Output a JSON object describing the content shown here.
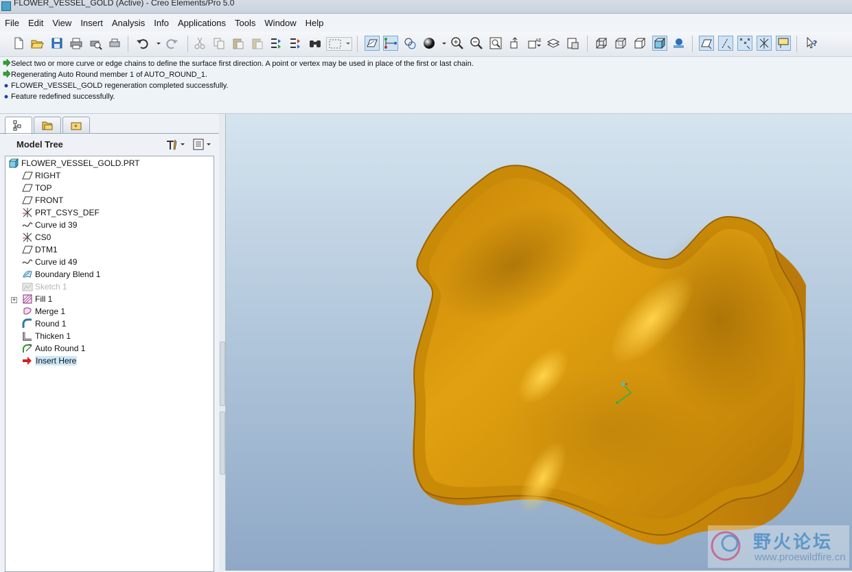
{
  "window": {
    "title": "FLOWER_VESSEL_GOLD (Active) - Creo Elements/Pro 5.0"
  },
  "menu": [
    "File",
    "Edit",
    "View",
    "Insert",
    "Analysis",
    "Info",
    "Applications",
    "Tools",
    "Window",
    "Help"
  ],
  "toolbar_icons": [
    "new-file-icon",
    "open-file-icon",
    "save-icon",
    "print-icon",
    "print-preview-icon",
    "print-setup-icon",
    "undo-icon",
    "redo-icon",
    "cut-icon",
    "copy-icon",
    "paste-icon",
    "paste-special-icon",
    "regenerate-icon",
    "regen-manager-icon",
    "find-icon",
    "selection-box-icon",
    "datum-planes-icon",
    "datum-axes-icon",
    "datum-points-icon",
    "appearance-icon",
    "zoom-in-icon",
    "zoom-out-icon",
    "refit-icon",
    "reorient-icon",
    "saved-views-icon",
    "layers-icon",
    "view-manager-icon",
    "wireframe-icon",
    "hidden-line-icon",
    "no-hidden-icon",
    "shading-icon",
    "shading-edges-icon",
    "plane-display-icon",
    "axis-display-icon",
    "point-display-icon",
    "csys-display-icon",
    "annotation-display-icon",
    "whats-this-icon"
  ],
  "messages": [
    {
      "type": "prompt",
      "text": "Select two or more curve or edge chains to define the surface first direction. A point or vertex may be used in place of the first or last chain."
    },
    {
      "type": "prompt",
      "text": "Regenerating Auto Round member 1 of AUTO_ROUND_1."
    },
    {
      "type": "info",
      "text": "FLOWER_VESSEL_GOLD regeneration completed successfully."
    },
    {
      "type": "info",
      "text": "Feature redefined successfully."
    }
  ],
  "model_tree": {
    "title": "Model Tree",
    "root": "FLOWER_VESSEL_GOLD.PRT",
    "items": [
      {
        "label": "RIGHT",
        "icon": "datum-plane-icon"
      },
      {
        "label": "TOP",
        "icon": "datum-plane-icon"
      },
      {
        "label": "FRONT",
        "icon": "datum-plane-icon"
      },
      {
        "label": "PRT_CSYS_DEF",
        "icon": "csys-icon"
      },
      {
        "label": "Curve id 39",
        "icon": "curve-icon"
      },
      {
        "label": "CS0",
        "icon": "csys-icon"
      },
      {
        "label": "DTM1",
        "icon": "datum-plane-icon"
      },
      {
        "label": "Curve id 49",
        "icon": "curve-icon"
      },
      {
        "label": "Boundary Blend 1",
        "icon": "boundary-blend-icon"
      },
      {
        "label": "Sketch 1",
        "icon": "sketch-icon",
        "suppressed": true
      },
      {
        "label": "Fill 1",
        "icon": "fill-icon",
        "expandable": true
      },
      {
        "label": "Merge 1",
        "icon": "merge-icon"
      },
      {
        "label": "Round 1",
        "icon": "round-icon"
      },
      {
        "label": "Thicken 1",
        "icon": "thicken-icon"
      },
      {
        "label": "Auto Round 1",
        "icon": "auto-round-icon"
      },
      {
        "label": "Insert Here",
        "icon": "insert-arrow-icon",
        "highlight": true
      }
    ]
  },
  "watermark": {
    "text": "野火论坛",
    "url": "www.proewildfire.cn"
  },
  "colors": {
    "model_gold": "#d99a0c",
    "viewport_top": "#d5e4ef",
    "viewport_bottom": "#8ea8c6",
    "accent": "#4e8fc4"
  }
}
